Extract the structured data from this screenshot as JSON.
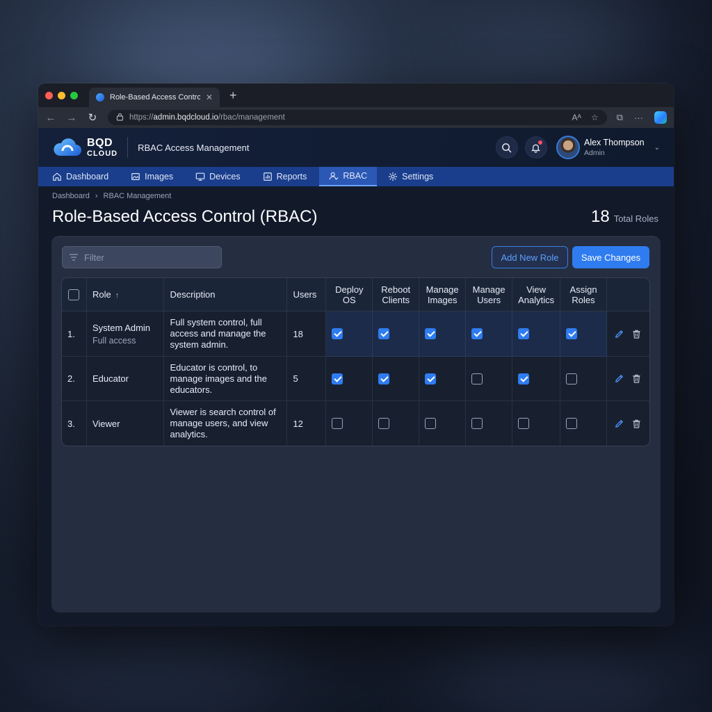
{
  "browser": {
    "tab_title": "Role-Based Access Control",
    "url_prefix": "https://",
    "url_host": "admin.bqdcloud.io",
    "url_path": "/rbac/management"
  },
  "app": {
    "logo_main": "BQD",
    "logo_sub": "CLOUD",
    "header_title": "RBAC Access Management",
    "user_name": "Alex Thompson",
    "user_role": "Admin"
  },
  "nav": [
    {
      "label": "Dashboard",
      "icon": "home-icon"
    },
    {
      "label": "Images",
      "icon": "image-icon"
    },
    {
      "label": "Devices",
      "icon": "monitor-icon"
    },
    {
      "label": "Reports",
      "icon": "chart-icon"
    },
    {
      "label": "RBAC",
      "icon": "users-icon",
      "active": true
    },
    {
      "label": "Settings",
      "icon": "gear-icon"
    }
  ],
  "breadcrumb": [
    "Dashboard",
    "RBAC Management"
  ],
  "page": {
    "title": "Role-Based Access Control (RBAC)",
    "total_count": "18",
    "total_label": "Total Roles"
  },
  "toolbar": {
    "filter_placeholder": "Filter",
    "add_role": "Add New Role",
    "save": "Save Changes"
  },
  "table": {
    "headers": {
      "role": "Role",
      "description": "Description",
      "users": "Users",
      "perms": [
        [
          "Deploy",
          "OS"
        ],
        [
          "Reboot",
          "Clients"
        ],
        [
          "Manage",
          "Images"
        ],
        [
          "Manage",
          "Users"
        ],
        [
          "View",
          "Analytics"
        ],
        [
          "Assign",
          "Roles"
        ]
      ]
    },
    "rows": [
      {
        "index": "1.",
        "role": "System Admin",
        "role_sub": "Full access",
        "description": "Full system control,  full access and manage the system admin.",
        "users": "18",
        "perms": [
          true,
          true,
          true,
          true,
          true,
          true
        ]
      },
      {
        "index": "2.",
        "role": "Educator",
        "role_sub": "",
        "description": "Educator is control, to manage images and the educators.",
        "users": "5",
        "perms": [
          true,
          true,
          true,
          false,
          true,
          false
        ]
      },
      {
        "index": "3.",
        "role": "Viewer",
        "role_sub": "",
        "description": "Viewer is search control of manage users, and view analytics.",
        "users": "12",
        "perms": [
          false,
          false,
          false,
          false,
          false,
          false
        ]
      }
    ]
  },
  "colors": {
    "accent": "#2f7cf0",
    "navbar": "#1a3e8c",
    "notification": "#ff4d6a"
  }
}
